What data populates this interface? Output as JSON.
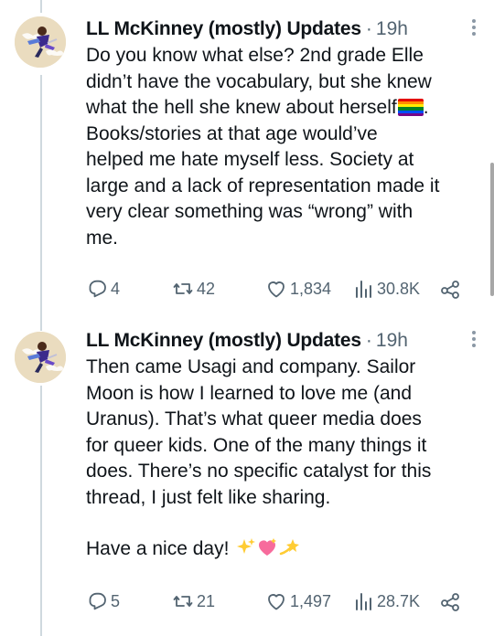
{
  "tweets": [
    {
      "author": "LL McKinney (mostly) Updates",
      "separator": "·",
      "time": "19h",
      "text_lines": [
        "Do you know what else? 2nd grade Elle",
        "didn’t have the vocabulary, but she knew",
        "what the hell she knew about herself",
        "Books/stories at that age would’ve",
        "helped me hate myself less. Society at",
        "large and a lack of representation made it",
        "very clear something was “wrong” with",
        "me."
      ],
      "inline_emoji": "rainbow-flag",
      "after_flag": ".",
      "stats": {
        "replies": "4",
        "reposts": "42",
        "likes": "1,834",
        "views": "30.8K"
      }
    },
    {
      "author": "LL McKinney (mostly) Updates",
      "separator": "·",
      "time": "19h",
      "text_lines": [
        "Then came Usagi and company. Sailor",
        "Moon is how I learned to love me (and",
        "Uranus). That’s what queer media does",
        "for queer kids. One of the many things it",
        "does. There’s no specific catalyst for this",
        "thread, I just felt like sharing."
      ],
      "closing_line": "Have a nice day!",
      "closing_emoji": [
        "sparkles",
        "sparkling-heart",
        "dizzy"
      ],
      "stats": {
        "replies": "5",
        "reposts": "21",
        "likes": "1,497",
        "views": "28.7K"
      }
    }
  ],
  "icons": {
    "reply": "reply-icon",
    "repost": "repost-icon",
    "like": "heart-icon",
    "views": "views-icon",
    "share": "share-icon"
  },
  "colors": {
    "text": "#0f1419",
    "secondary": "#536471",
    "thread_line": "#cfd9de",
    "avatar_bg": "#eadcbf"
  }
}
